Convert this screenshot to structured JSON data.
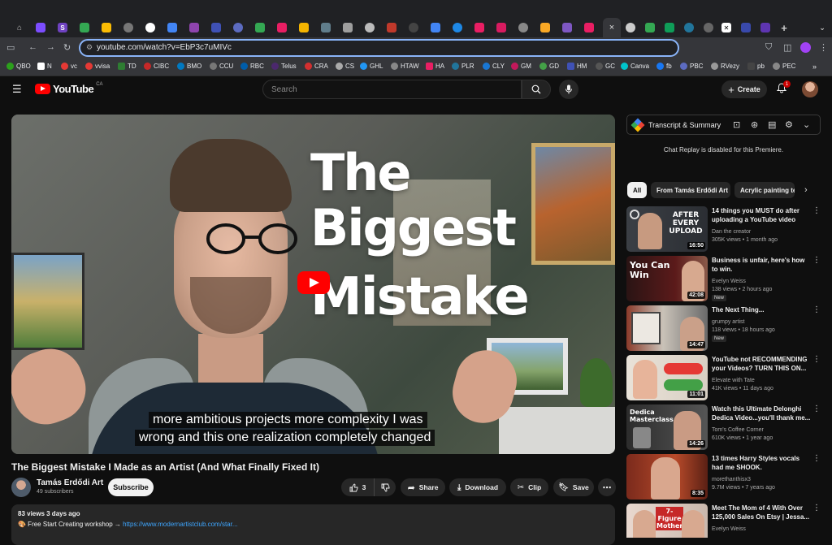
{
  "browser": {
    "url": "youtube.com/watch?v=EbP3c7uMIVc",
    "bookmarks": [
      "QBO",
      "N",
      "vc",
      "vvisa",
      "TD",
      "CIBC",
      "BMO",
      "CCU",
      "RBC",
      "Telus",
      "CRA",
      "CS",
      "GHL",
      "HTAW",
      "HA",
      "PLR",
      "CLY",
      "GM",
      "GD",
      "HM",
      "GC",
      "Canva",
      "fb",
      "PBC",
      "RVezy",
      "pb",
      "PEC"
    ],
    "active_tab_close": "×"
  },
  "youtube": {
    "logo_word": "YouTube",
    "country": "CA",
    "search_placeholder": "Search",
    "create_label": "Create",
    "notification_count": "1"
  },
  "video": {
    "overlay_line1": "The",
    "overlay_line2": "Biggest",
    "overlay_line3": "Mistake",
    "caption_line1": "more ambitious projects more complexity I was",
    "caption_line2": "wrong and this one realization completely changed",
    "title": "The Biggest Mistake I Made as an Artist (And What Finally Fixed It)",
    "channel": "Tamás Erdődi Art",
    "subscribers": "49 subscribers",
    "subscribe_label": "Subscribe",
    "likes": "3",
    "share_label": "Share",
    "download_label": "Download",
    "clip_label": "Clip",
    "save_label": "Save",
    "views_date": "83 views  3 days ago",
    "desc_prefix": "🎨 Free Start Creating  workshop → ",
    "desc_link": "https://www.modernartistclub.com/star..."
  },
  "sidebar": {
    "panel_title": "Transcript & Summary",
    "chat_disabled": "Chat Replay is disabled for this Premiere.",
    "chips": [
      "All",
      "From Tamás Erdődi Art",
      "Acrylic painting te"
    ],
    "recommendations": [
      {
        "title": "14 things you MUST do after uploading a YouTube video",
        "channel": "Dan the creator",
        "meta": "305K views • 1 month ago",
        "duration": "16:50",
        "new": "",
        "thumb_text": "AFTER EVERY UPLOAD"
      },
      {
        "title": "Business is unfair, here's how to win.",
        "channel": "Evelyn Weiss",
        "meta": "138 views • 2 hours ago",
        "duration": "42:08",
        "new": "New",
        "thumb_text": "You Can Win"
      },
      {
        "title": "The Next Thing...",
        "channel": "grumpy artist",
        "meta": "118 views • 18 hours ago",
        "duration": "14:47",
        "new": "New",
        "thumb_text": ""
      },
      {
        "title": "YouTube not RECOMMENDING your Videos? TURN THIS ON...",
        "channel": "Elevate with Tate",
        "meta": "41K views • 11 days ago",
        "duration": "11:01",
        "new": "",
        "thumb_text": ""
      },
      {
        "title": "Watch this Ultimate Delonghi Dedica Video...you'll thank me...",
        "channel": "Tom's Coffee Corner",
        "meta": "610K views • 1 year ago",
        "duration": "14:26",
        "new": "",
        "thumb_text": "Dedica Masterclass."
      },
      {
        "title": "13 times Harry Styles vocals had me SHOOK.",
        "channel": "morethanthisx3",
        "meta": "9.7M views • 7 years ago",
        "duration": "8:35",
        "new": "",
        "thumb_text": ""
      },
      {
        "title": "Meet The Mom of 4 With Over 125,000 Sales On Etsy | Jessa...",
        "channel": "Evelyn Weiss",
        "meta": "",
        "duration": "",
        "new": "",
        "thumb_text": "7-Figure Mother"
      }
    ]
  }
}
